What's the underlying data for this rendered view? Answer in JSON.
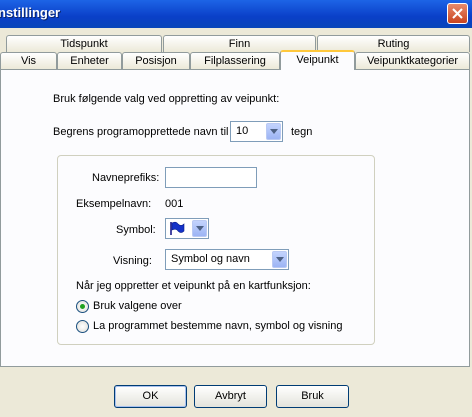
{
  "window": {
    "title": "nstillinger"
  },
  "tabs_row1": [
    {
      "label": "Tidspunkt"
    },
    {
      "label": "Finn"
    },
    {
      "label": "Ruting"
    }
  ],
  "tabs_row2": [
    {
      "label": "Vis"
    },
    {
      "label": "Enheter"
    },
    {
      "label": "Posisjon"
    },
    {
      "label": "Filplassering"
    },
    {
      "label": "Veipunkt",
      "active": true
    },
    {
      "label": "Veipunktkategorier"
    }
  ],
  "panel": {
    "intro": "Bruk følgende valg ved oppretting av veipunkt:",
    "limit_label": "Begrens programopprettede navn til",
    "limit_value": "10",
    "limit_unit": "tegn",
    "prefix_label": "Navneprefiks:",
    "prefix_value": "",
    "example_label": "Eksempelnavn:",
    "example_value": "001",
    "symbol_label": "Symbol:",
    "symbol_icon": "blue-flag-icon",
    "display_label": "Visning:",
    "display_value": "Symbol og navn",
    "map_question": "Når jeg oppretter et veipunkt på en kartfunksjon:",
    "radio_options": [
      {
        "label": "Bruk valgene over",
        "selected": true
      },
      {
        "label": "La programmet bestemme navn, symbol og visning",
        "selected": false
      }
    ]
  },
  "buttons": {
    "ok": "OK",
    "cancel": "Avbryt",
    "apply": "Bruk"
  },
  "colors": {
    "title_bar": "#0a3fc8",
    "active_tab_accent": "#ffc83c",
    "radio_dot": "#21a121",
    "flag": "#1432c8"
  }
}
